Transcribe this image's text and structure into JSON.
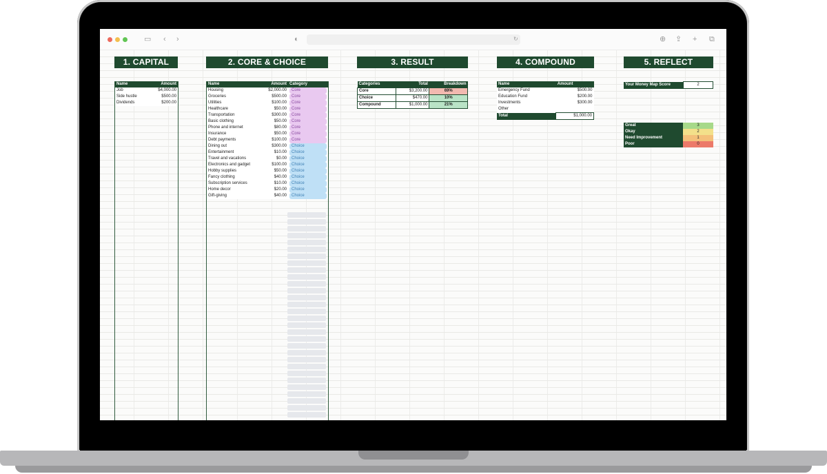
{
  "capital": {
    "title": "1. CAPITAL",
    "headers": [
      "Name",
      "Amount"
    ],
    "rows": [
      {
        "name": "Job",
        "amount": "$4,000.00"
      },
      {
        "name": "Side hustle",
        "amount": "$500.00"
      },
      {
        "name": "Dividends",
        "amount": "$200.00"
      }
    ]
  },
  "core_choice": {
    "title": "2. CORE & CHOICE",
    "headers": [
      "Name",
      "Amount",
      "Category"
    ],
    "rows": [
      {
        "name": "Housing",
        "amount": "$2,000.00",
        "category": "Core"
      },
      {
        "name": "Groceries",
        "amount": "$500.00",
        "category": "Core"
      },
      {
        "name": "Utilities",
        "amount": "$100.00",
        "category": "Core"
      },
      {
        "name": "Healthcare",
        "amount": "$50.00",
        "category": "Core"
      },
      {
        "name": "Transportation",
        "amount": "$300.00",
        "category": "Core"
      },
      {
        "name": "Basic clothing",
        "amount": "$50.00",
        "category": "Core"
      },
      {
        "name": "Phone and internet",
        "amount": "$80.00",
        "category": "Core"
      },
      {
        "name": "Insurance",
        "amount": "$50.00",
        "category": "Core"
      },
      {
        "name": "Debt payments",
        "amount": "$100.00",
        "category": "Core"
      },
      {
        "name": "Dining out",
        "amount": "$300.00",
        "category": "Choice"
      },
      {
        "name": "Entertainment",
        "amount": "$10.00",
        "category": "Choice"
      },
      {
        "name": "Travel and vacations",
        "amount": "$0.00",
        "category": "Choice"
      },
      {
        "name": "Electronics and gadget",
        "amount": "$100.00",
        "category": "Choice"
      },
      {
        "name": "Hobby supplies",
        "amount": "$50.00",
        "category": "Choice"
      },
      {
        "name": "Fancy clothing",
        "amount": "$40.00",
        "category": "Choice"
      },
      {
        "name": "Subscription services",
        "amount": "$10.00",
        "category": "Choice"
      },
      {
        "name": "Home decor",
        "amount": "$20.00",
        "category": "Choice"
      },
      {
        "name": "Gift-giving",
        "amount": "$40.00",
        "category": "Choice"
      }
    ]
  },
  "result": {
    "title": "3. RESULT",
    "headers": [
      "Categories",
      "Total",
      "Breakdown"
    ],
    "rows": [
      {
        "name": "Core",
        "total": "$3,200.00",
        "breakdown": "69%",
        "color": "#f2b9b0"
      },
      {
        "name": "Choice",
        "total": "$470.00",
        "breakdown": "10%",
        "color": "#b9e3c6"
      },
      {
        "name": "Compound",
        "total": "$1,000.00",
        "breakdown": "21%",
        "color": "#b9e3c6"
      }
    ]
  },
  "compound": {
    "title": "4. COMPOUND",
    "headers": [
      "Name",
      "Amount"
    ],
    "rows": [
      {
        "name": "Emergency Fund",
        "amount": "$500.00"
      },
      {
        "name": "Education Fund",
        "amount": "$200.00"
      },
      {
        "name": "Investments",
        "amount": "$300.00"
      },
      {
        "name": "Other",
        "amount": ""
      }
    ],
    "total_label": "Total",
    "total_value": "$1,000.00"
  },
  "reflect": {
    "title": "5. REFLECT",
    "score_label": "Your Money Map Score",
    "score_value": "2",
    "legend": [
      {
        "label": "Great",
        "value": "3",
        "color": "#a7d98a"
      },
      {
        "label": "Okay",
        "value": "2",
        "color": "#f3e08a"
      },
      {
        "label": "Need Improvement",
        "value": "1",
        "color": "#f4c07a"
      },
      {
        "label": "Poor",
        "value": "0",
        "color": "#ec7a6a"
      }
    ]
  },
  "colors": {
    "header_green": "#1f4a2f",
    "core_pill": "#e9c9f0",
    "choice_pill": "#bfe0f6"
  }
}
